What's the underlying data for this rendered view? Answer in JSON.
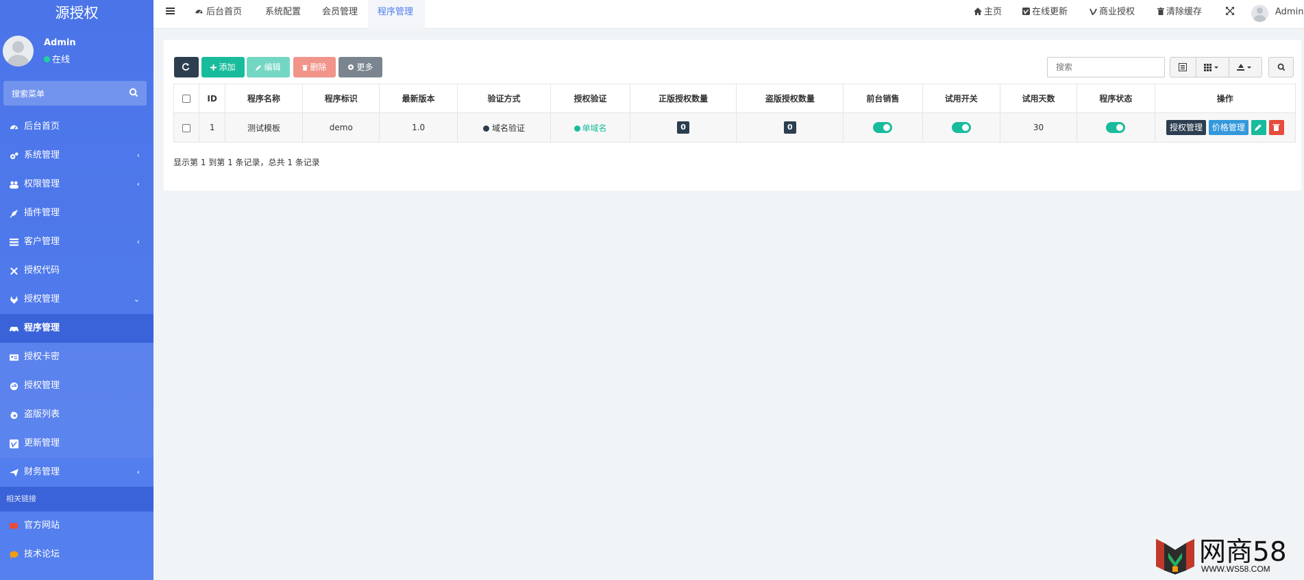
{
  "app": {
    "logo": "源授权"
  },
  "user": {
    "name": "Admin",
    "status": "在线"
  },
  "sidebar": {
    "search_label": "搜索菜单",
    "items": [
      {
        "label": "后台首页",
        "icon": "dashboard-icon"
      },
      {
        "label": "系统管理",
        "icon": "cogs-icon",
        "caret": "‹"
      },
      {
        "label": "权限管理",
        "icon": "group-icon",
        "caret": "‹"
      },
      {
        "label": "插件管理",
        "icon": "rocket-icon"
      },
      {
        "label": "客户管理",
        "icon": "list-icon",
        "caret": "‹"
      },
      {
        "label": "授权代码",
        "icon": "code-icon"
      },
      {
        "label": "授权管理",
        "icon": "gitlab-icon",
        "caret": "⌄"
      },
      {
        "label": "程序管理",
        "icon": "car-icon"
      },
      {
        "label": "授权卡密",
        "icon": "id-card-icon"
      },
      {
        "label": "授权管理",
        "icon": "internet-explorer-icon"
      },
      {
        "label": "盗版列表",
        "icon": "firefox-icon"
      },
      {
        "label": "更新管理",
        "icon": "vimeo-icon"
      },
      {
        "label": "财务管理",
        "icon": "paper-plane-icon",
        "caret": "‹"
      }
    ],
    "links_header": "相关链接",
    "links": [
      {
        "label": "官方网站",
        "icon": "flag-icon"
      },
      {
        "label": "技术论坛",
        "icon": "comment-icon"
      }
    ]
  },
  "topnav": {
    "tabs": [
      {
        "label": "后台首页"
      },
      {
        "label": "系统配置"
      },
      {
        "label": "会员管理"
      },
      {
        "label": "程序管理"
      }
    ],
    "right": [
      {
        "label": "主页",
        "icon": "home-icon"
      },
      {
        "label": "在线更新",
        "icon": "vimeo-icon"
      },
      {
        "label": "商业授权",
        "icon": "vine-icon"
      },
      {
        "label": "清除缓存",
        "icon": "trash-icon"
      }
    ],
    "user": "Admin"
  },
  "toolbar": {
    "add": "添加",
    "edit": "编辑",
    "delete": "删除",
    "more": "更多",
    "search_placeholder": "搜索"
  },
  "colors": {
    "sidebar": "#4a74e8",
    "primary_dark": "#2c3e50",
    "success": "#18bc9c",
    "danger": "#e74c3c",
    "info": "#3498db",
    "more": "#6c757d"
  },
  "table": {
    "headers": [
      "ID",
      "程序名称",
      "程序标识",
      "最新版本",
      "验证方式",
      "授权验证",
      "正版授权数量",
      "盗版授权数量",
      "前台销售",
      "试用开关",
      "试用天数",
      "程序状态",
      "操作"
    ],
    "rows": [
      {
        "id": "1",
        "name": "测试模板",
        "ident": "demo",
        "version": "1.0",
        "verify": "域名验证",
        "auth": "单域名",
        "genuine": "0",
        "pirated": "0",
        "sale": true,
        "trial": true,
        "trial_days": "30",
        "state": true,
        "actions": {
          "auth_manage": "授权管理",
          "price_manage": "价格管理"
        }
      }
    ]
  },
  "pagination": {
    "info": "显示第 1 到第 1 条记录，总共 1 条记录"
  },
  "watermark": {
    "text": "网商58",
    "url": "WWW.WS58.COM"
  }
}
